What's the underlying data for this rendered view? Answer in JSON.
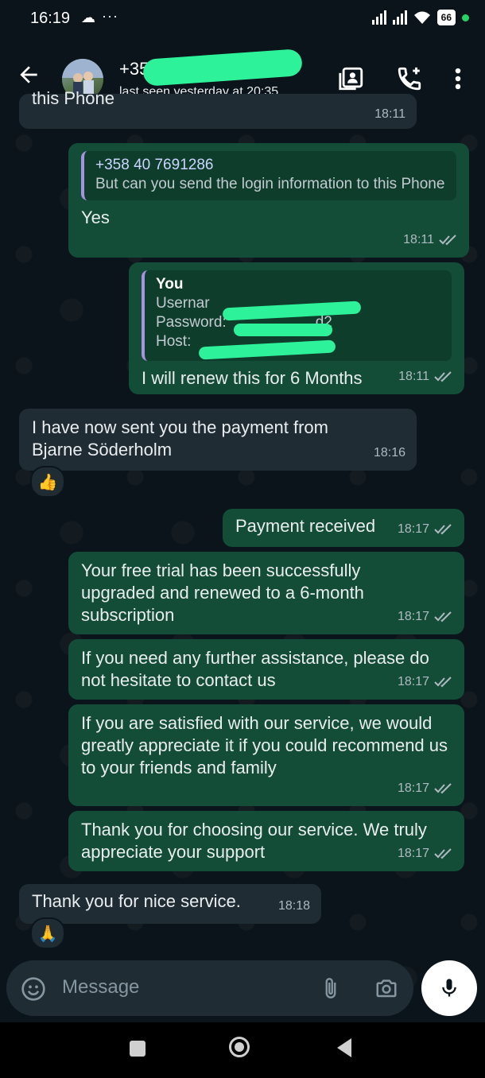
{
  "status_bar": {
    "time": "16:19",
    "battery": "66"
  },
  "header": {
    "contact_name": "+358",
    "last_seen": "last seen yesterday at 20:35"
  },
  "messages": [
    {
      "direction": "out",
      "partial_text": "this Phone",
      "time": "18:11"
    },
    {
      "direction": "out",
      "quote_author": "+358 40 7691286",
      "quote_text": "But can you send the login information to this Phone",
      "text": "Yes",
      "time": "18:11"
    },
    {
      "direction": "out",
      "quote_author": "You",
      "quote_lines": [
        "Usernar",
        "Password:",
        "Host:"
      ],
      "quote_fragment": "d2",
      "text": "I will renew this for 6 Months",
      "time": "18:11"
    },
    {
      "direction": "in",
      "text": "I have now sent you the payment from Bjarne Söderholm",
      "time": "18:16",
      "reaction": "👍"
    },
    {
      "direction": "out",
      "text": "Payment received",
      "time": "18:17"
    },
    {
      "direction": "out",
      "text": "Your free trial  has been successfully upgraded and renewed to a 6-month subscription",
      "time": "18:17"
    },
    {
      "direction": "out",
      "text": "If you need any further assistance, please do not hesitate to contact us",
      "time": "18:17"
    },
    {
      "direction": "out",
      "text": "If you are satisfied with our service, we would greatly appreciate it if you could recommend us to your friends and family",
      "time": "18:17"
    },
    {
      "direction": "out",
      "text": "Thank you for choosing our service. We truly appreciate your support",
      "time": "18:17"
    },
    {
      "direction": "in",
      "text": "Thank you for nice service.",
      "time": "18:18",
      "reaction": "🙏"
    }
  ],
  "input": {
    "placeholder": "Message"
  },
  "colors": {
    "outgoing_bubble": "#144d37",
    "incoming_bubble": "#202c33",
    "background": "#0b141a",
    "accent": "#25d366"
  },
  "icons": [
    "back-arrow-icon",
    "contact-card-icon",
    "add-call-icon",
    "more-vert-icon",
    "emoji-icon",
    "attach-icon",
    "camera-icon",
    "mic-icon"
  ]
}
